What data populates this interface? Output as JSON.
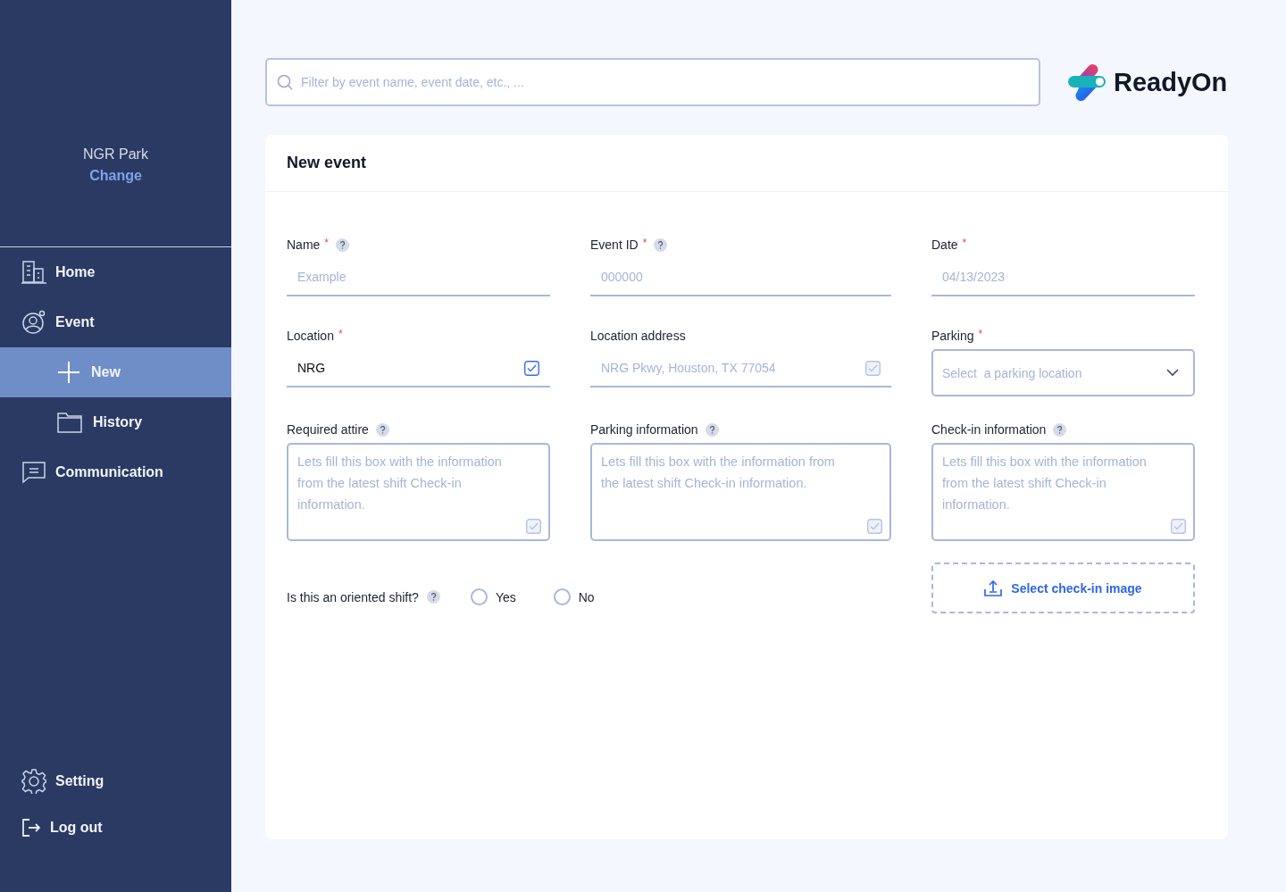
{
  "sidebar": {
    "venue": "NGR Park",
    "change_link": "Change",
    "nav": [
      {
        "label": "Home",
        "selected": false
      },
      {
        "label": "Event",
        "selected": false,
        "children": [
          {
            "label": "New",
            "selected": true
          },
          {
            "label": "History",
            "selected": false
          }
        ]
      },
      {
        "label": "Communication",
        "selected": false
      }
    ],
    "bottom": [
      {
        "label": "Setting"
      },
      {
        "label": "Log out"
      }
    ]
  },
  "search": {
    "placeholder": "Filter by event name, event date, etc., ..."
  },
  "logo": {
    "text": "ReadyOn"
  },
  "form": {
    "title": "New event",
    "fields": [
      {
        "kind": "text",
        "label": "Name",
        "required_mark": "*",
        "help": true,
        "placeholder": "Example"
      },
      {
        "kind": "text",
        "label": "Event ID",
        "required_mark": "*",
        "help": true,
        "placeholder": "000000"
      },
      {
        "kind": "text",
        "label": "Date",
        "required_mark": "*",
        "help": false,
        "placeholder": "04/13/2023"
      },
      {
        "kind": "text",
        "label": "Location",
        "required_mark": "*",
        "help": false,
        "value": "NRG",
        "checkbox": {
          "checked": true,
          "disabled": false
        }
      },
      {
        "kind": "text",
        "label": "Location address",
        "help": false,
        "placeholder": "NRG Pkwy, Houston, TX 77054",
        "checkbox": {
          "checked": true,
          "disabled": true
        }
      },
      {
        "kind": "select",
        "label": "Parking",
        "required_mark": "*",
        "help": false,
        "placeholder": "Select  a parking location"
      },
      {
        "kind": "textarea",
        "label": "Required attire",
        "help": true,
        "placeholder": "Lets fill this box with the information from the latest shift Check-in information.",
        "checkbox": {
          "checked": true,
          "disabled": true
        }
      },
      {
        "kind": "textarea",
        "label": "Parking information",
        "help": true,
        "placeholder": "Lets fill this box with the information from the latest shift Check-in information.",
        "checkbox": {
          "checked": true,
          "disabled": true
        }
      },
      {
        "kind": "textarea",
        "label": "Check-in information",
        "help": true,
        "placeholder": "Lets fill this box with the information from the latest shift Check-in information.",
        "checkbox": {
          "checked": true,
          "disabled": true
        }
      }
    ],
    "question": {
      "label": "Is this an oriented shift?",
      "help": true,
      "options": [
        {
          "label": "Yes",
          "selected": false
        },
        {
          "label": "No",
          "selected": false
        }
      ]
    },
    "upload_button": "Select check-in image"
  }
}
